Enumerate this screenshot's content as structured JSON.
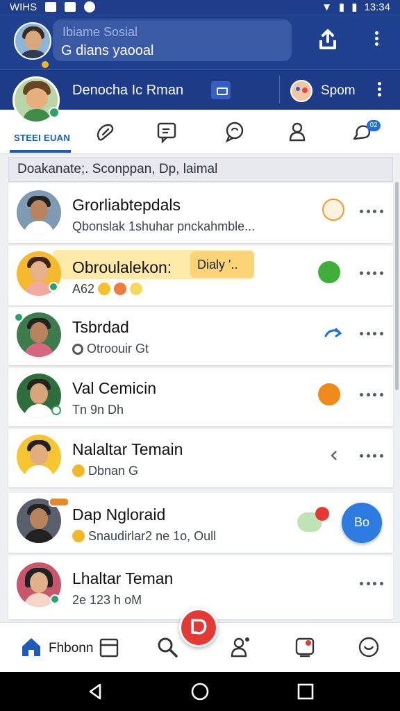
{
  "status_bar": {
    "carrier": "WIHS",
    "time": "13:34"
  },
  "header": {
    "title": "Ibiame Sosial",
    "subtitle": "G dians yaooal"
  },
  "profile": {
    "name": "Denocha Ic Rman",
    "secondary_label": "Spom"
  },
  "tabs": {
    "active_label": "STEEI EUAN",
    "badge": "02"
  },
  "list": {
    "section_title": "Doakanate;. Sconppan, Dp, laimal",
    "contacts": [
      {
        "name": "Grorliabtepdals",
        "subtitle": "Qbonslak 1shuhar pnckahmble...",
        "status_color": "#f29a2e"
      },
      {
        "name": "Obroulalekon:",
        "tag": "Dialy '..",
        "subtitle": "A62",
        "status_color": "#3fae3a"
      },
      {
        "name": "Tsbrdad",
        "subtitle": "Otroouir Gt",
        "status_color": "#1f6fd8"
      },
      {
        "name": "Val Cemicin",
        "subtitle": "Tn  9n Dh",
        "status_color": "#f08a1c"
      },
      {
        "name": "Nalaltar Temain",
        "subtitle": "Dbnan  G",
        "status_color": "#777"
      },
      {
        "name": "Dap Nglorаid",
        "subtitle": "Snaudirlar2 ne 1o, Oull",
        "status_color": "#e53935"
      },
      {
        "name": "Lhaltar Teman",
        "subtitle": "2e  123 h oM",
        "status_color": "#555"
      }
    ]
  },
  "fab": {
    "label": "Bo"
  },
  "bottom_nav": {
    "home_label": "Fhbonn"
  },
  "colors": {
    "brand": "#20418f",
    "accent": "#1e5ab7",
    "fab": "#2d7be0",
    "center_button": "#e53935"
  }
}
